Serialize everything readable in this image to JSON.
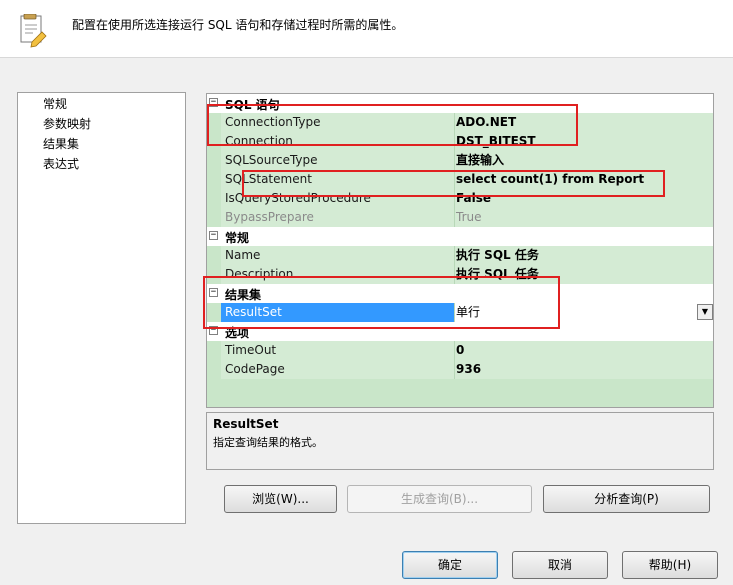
{
  "header": {
    "description": "配置在使用所选连接运行 SQL 语句和存储过程时所需的属性。",
    "icon": "task-properties-icon"
  },
  "nav": {
    "items": [
      {
        "label": "常规"
      },
      {
        "label": "参数映射"
      },
      {
        "label": "结果集"
      },
      {
        "label": "表达式"
      }
    ]
  },
  "grid": {
    "categories": [
      {
        "label": "SQL 语句",
        "toggle": "⊟",
        "properties": [
          {
            "name": "ConnectionType",
            "value": "ADO.NET"
          },
          {
            "name": "Connection",
            "value": "DST_BITEST"
          },
          {
            "name": "SQLSourceType",
            "value": "直接输入"
          },
          {
            "name": "SQLStatement",
            "value": "select count(1) from Report"
          },
          {
            "name": "IsQueryStoredProcedure",
            "value": "False"
          },
          {
            "name": "BypassPrepare",
            "value": "True"
          }
        ]
      },
      {
        "label": "常规",
        "toggle": "⊟",
        "properties": [
          {
            "name": "Name",
            "value": "执行 SQL 任务"
          },
          {
            "name": "Description",
            "value": "执行 SQL 任务"
          }
        ]
      },
      {
        "label": "结果集",
        "toggle": "⊟",
        "properties": [
          {
            "name": "ResultSet",
            "value": "单行"
          }
        ]
      },
      {
        "label": "选项",
        "toggle": "⊟",
        "properties": [
          {
            "name": "TimeOut",
            "value": "0"
          },
          {
            "name": "CodePage",
            "value": "936"
          }
        ]
      }
    ],
    "dropdown_glyph": "▼"
  },
  "help": {
    "title": "ResultSet",
    "description": "指定查询结果的格式。"
  },
  "buttons": {
    "browse": "浏览(W)...",
    "build_query": "生成查询(B)...",
    "parse_query": "分析查询(P)",
    "ok": "确定",
    "cancel": "取消",
    "help": "帮助(H)"
  },
  "colors": {
    "grid_bg": "#c9e6c9",
    "selection": "#3399ff",
    "annotation": "#e02020"
  }
}
